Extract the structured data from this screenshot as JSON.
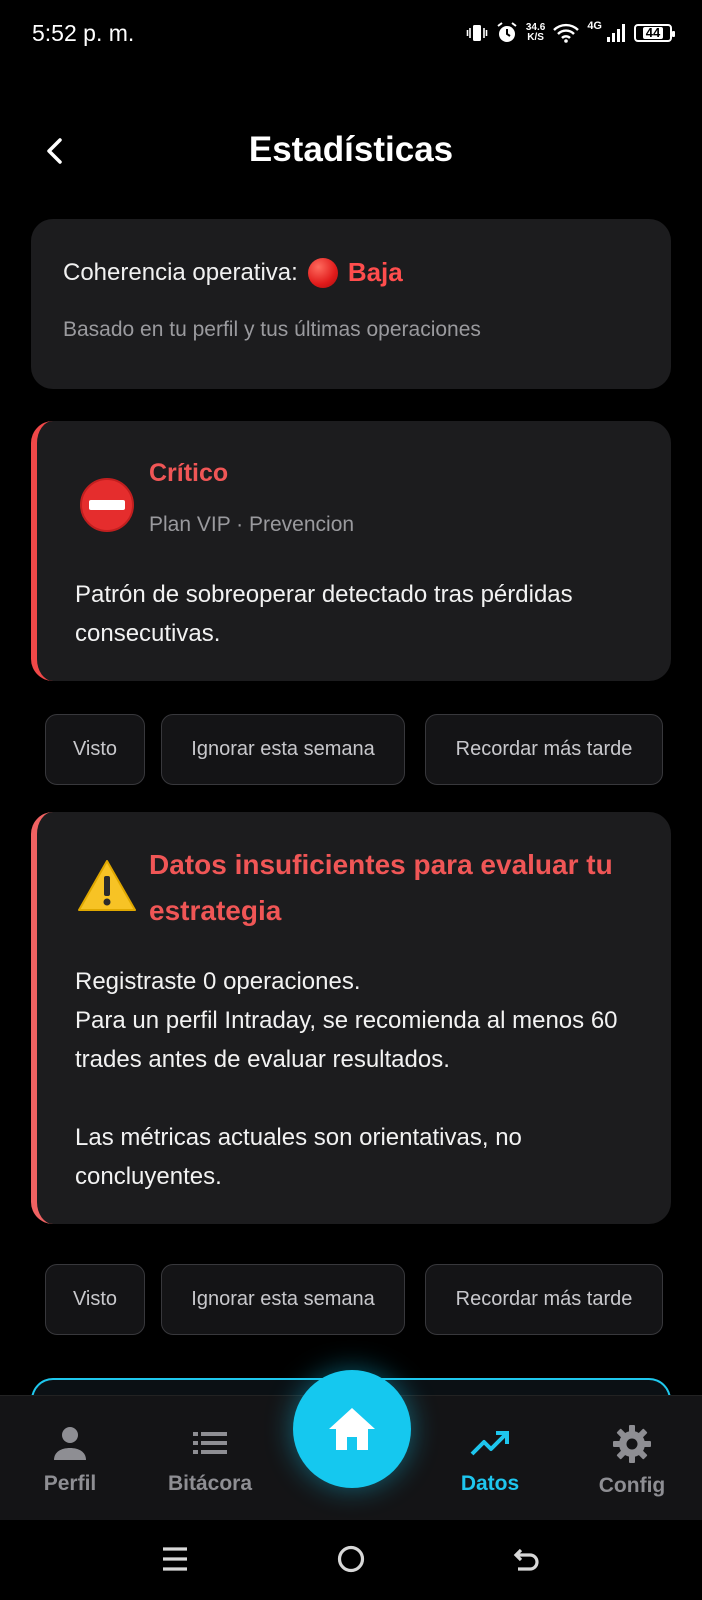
{
  "status_bar": {
    "time": "5:52 p. m.",
    "speed_value": "34.6",
    "speed_unit": "K/S",
    "network": "4G",
    "battery": "44"
  },
  "header": {
    "title": "Estadísticas"
  },
  "coherence": {
    "label": "Coherencia operativa:",
    "value": "Baja",
    "subtitle": "Basado en tu perfil y tus últimas operaciones"
  },
  "alerts": [
    {
      "title": "Crítico",
      "subtitle": "Plan VIP · Prevencion",
      "body": "Patrón de sobreoperar detectado tras pérdidas consecutivas.",
      "icon": "no-entry-icon"
    },
    {
      "title": "Datos insuficientes para evaluar tu estrategia",
      "body_lines": [
        "Registraste 0 operaciones.",
        "Para un perfil Intraday, se recomienda al menos 60 trades antes de evaluar resultados.",
        "Las métricas actuales son orientativas, no concluyentes."
      ],
      "icon": "warning-icon"
    }
  ],
  "actions": {
    "seen": "Visto",
    "ignore_week": "Ignorar esta semana",
    "remind_later": "Recordar más tarde"
  },
  "bottom_nav": {
    "items": [
      {
        "label": "Perfil",
        "icon": "person-icon"
      },
      {
        "label": "Bitácora",
        "icon": "list-icon"
      },
      {
        "label": "Datos",
        "icon": "trending-up-icon"
      },
      {
        "label": "Config",
        "icon": "gear-icon"
      }
    ],
    "active": "Datos",
    "home_icon": "home-icon"
  },
  "colors": {
    "accent": "#15c8ef",
    "critical": "#f05656",
    "card_bg": "#1c1c1e",
    "background": "#000000"
  }
}
